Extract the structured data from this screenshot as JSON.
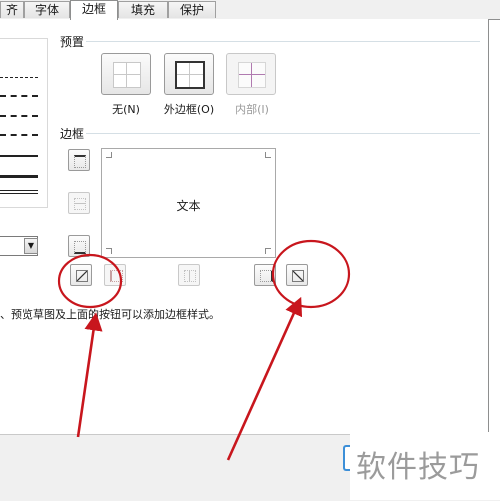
{
  "tabs": [
    {
      "label": "齐",
      "active": false
    },
    {
      "label": "字体",
      "active": false
    },
    {
      "label": "边框",
      "active": true
    },
    {
      "label": "填充",
      "active": false
    },
    {
      "label": "保护",
      "active": false
    }
  ],
  "presets": {
    "title": "预置",
    "items": [
      {
        "label": "无(N)",
        "icon": "border-none-icon",
        "enabled": true
      },
      {
        "label": "外边框(O)",
        "icon": "border-outline-icon",
        "enabled": true
      },
      {
        "label": "内部(I)",
        "icon": "border-inside-icon",
        "enabled": false
      }
    ]
  },
  "border": {
    "title": "边框",
    "preview_text": "文本",
    "buttons": {
      "top": "border-top-icon",
      "middle_horizontal": "border-middle-horizontal-icon",
      "bottom": "border-bottom-icon",
      "diagonal_up": "diagonal-up-icon",
      "left": "border-left-icon",
      "middle_vertical": "border-middle-vertical-icon",
      "right": "border-right-icon",
      "diagonal_down": "diagonal-down-icon"
    }
  },
  "hint": "、预览草图及上面的按钮可以添加边框样式。",
  "watermark": "软件技巧",
  "colors": {
    "annotation": "#c8161d",
    "selection": "#3c8fd8"
  }
}
